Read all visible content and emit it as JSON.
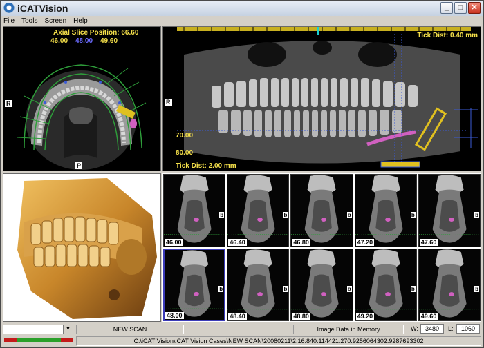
{
  "window": {
    "title": "iCATVision"
  },
  "menu": [
    "File",
    "Tools",
    "Screen",
    "Help"
  ],
  "axial": {
    "slice_position_label": "Axial Slice Position: 66.60",
    "pos_left": "46.00",
    "pos_mid": "48.00",
    "pos_right": "49.60",
    "side_left": "R",
    "side_bottom": "P"
  },
  "panoramic": {
    "tick_dist_top": "Tick Dist: 0.40 mm",
    "tick_dist_bottom": "Tick Dist: 2.00 mm",
    "side_left": "R",
    "depth_70": "70.00",
    "depth_80": "80.00"
  },
  "slices": [
    {
      "label": "46.00",
      "b": "b"
    },
    {
      "label": "46.40",
      "b": "b"
    },
    {
      "label": "46.80",
      "b": "b"
    },
    {
      "label": "47.20",
      "b": "b"
    },
    {
      "label": "47.60",
      "b": "b"
    },
    {
      "label": "48.00",
      "b": "b"
    },
    {
      "label": "48.40",
      "b": "b"
    },
    {
      "label": "48.80",
      "b": "b"
    },
    {
      "label": "49.20",
      "b": "b"
    },
    {
      "label": "49.60",
      "b": "b"
    }
  ],
  "status": {
    "scan_name": "NEW SCAN",
    "data_state": "Image Data in Memory",
    "w_label": "W:",
    "w_value": "3480",
    "l_label": "L:",
    "l_value": "1060",
    "path": "C:\\iCAT Vision\\iCAT Vision Cases\\NEW SCAN\\20080211\\2.16.840.114421.270.9256064302.9287693302"
  },
  "colors": {
    "overlay_yellow": "#f5e04a",
    "accent_pink": "#d060c0",
    "selection_blue": "#3b3bb8"
  }
}
